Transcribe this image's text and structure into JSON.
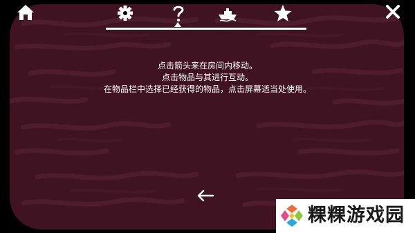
{
  "toolbar": {
    "home_icon": "home-icon",
    "close_icon": "close-icon",
    "tabs": [
      {
        "icon": "gear-icon",
        "name": "settings"
      },
      {
        "icon": "question-icon",
        "name": "help",
        "active": true
      },
      {
        "icon": "boat-icon",
        "name": "boat"
      },
      {
        "icon": "star-icon",
        "name": "star"
      }
    ]
  },
  "help": {
    "line1": "点击箭头来在房间内移动。",
    "line2": "点击物品与其进行互动。",
    "line3": "在物品栏中选择已经获得的物品，点击屏幕适当处使用。"
  },
  "navigation": {
    "back_icon": "arrow-left-icon"
  },
  "watermark": {
    "text": "粿粿游戏园"
  },
  "colors": {
    "panel": "#3f1322",
    "texture": "#4d1c2d",
    "icon": "#ffffff",
    "background": "#000000"
  }
}
